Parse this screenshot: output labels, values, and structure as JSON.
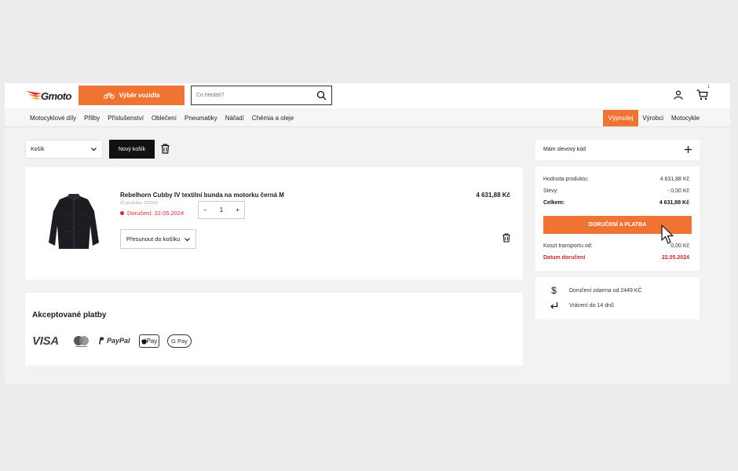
{
  "header": {
    "logo_text": "Gmoto",
    "vehicle_button": "Výběr vozidla",
    "search_placeholder": "Co hledáš?",
    "cart_count": "1"
  },
  "nav": {
    "left": [
      "Motocyklové díly",
      "Přilby",
      "Příslušenství",
      "Oblečení",
      "Pneumatiky",
      "Nářadí",
      "Chémia a oleje"
    ],
    "right": [
      "Výprodej",
      "Výrobci",
      "Motocykle"
    ]
  },
  "cart_controls": {
    "select_value": "Košík",
    "new_cart": "Nový košík"
  },
  "item": {
    "name": "Rebelhorn Cubby IV textilní bunda na motorku černá M",
    "product_id": "ID produktu 322502",
    "delivery": "Doručení: 22.05.2024",
    "quantity": "1",
    "price": "4 631,88 Kč",
    "move_label": "Přesunout do košíku"
  },
  "payments": {
    "title": "Akceptované platby",
    "visa": "VISA",
    "paypal": "PayPal",
    "apple_pay": "Pay",
    "google_pay": "G Pay"
  },
  "summary": {
    "discount_label": "Mám slevový kód",
    "product_value_label": "Hodnota produktu:",
    "product_value": "4 631,88 Kč",
    "discount_row_label": "Slevy:",
    "discount_value": "- 0,00 Kč",
    "total_label": "Celkem:",
    "total_value": "4 631,88 Kč",
    "checkout_button": "DORUČENÍ A PLATBA",
    "transport_label": "Koszt transportu od:",
    "transport_value": "0,00 Kč",
    "delivery_date_label": "Datum doručení",
    "delivery_date_value": "22.05.2024"
  },
  "info": {
    "free_delivery": "Doručení zdarma od 2449 KČ",
    "returns": "Vrácení do 14 dnů"
  },
  "colors": {
    "accent": "#ef7433",
    "danger": "#d7262c"
  }
}
